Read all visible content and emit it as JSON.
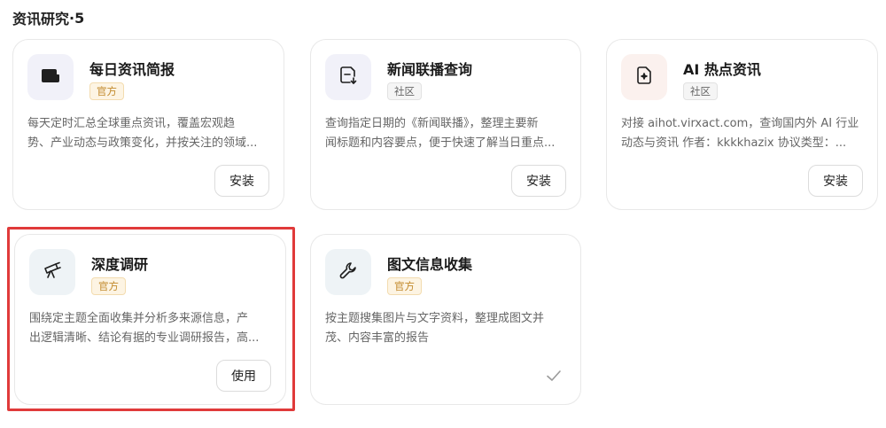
{
  "section": {
    "title": "资讯研究",
    "separator": "·",
    "count": "5"
  },
  "cards": [
    {
      "title": "每日资讯简报",
      "badge": "官方",
      "description": "每天定时汇总全球重点资讯，覆盖宏观趋\n势、产业动态与政策变化，并按关注的领域...",
      "action": "安装",
      "icon": "newspaper-icon"
    },
    {
      "title": "新闻联播查询",
      "badge": "社区",
      "description": "查询指定日期的《新闻联播》，整理主要新\n闻标题和内容要点，便于快速了解当日重点...",
      "action": "安装",
      "icon": "document-download-icon"
    },
    {
      "title": "AI 热点资讯",
      "badge": "社区",
      "description": "对接 aihot.virxact.com，查询国内外 AI 行业\n动态与资讯 作者：kkkkhazix 协议类型：...",
      "action": "安装",
      "icon": "document-sparkle-icon"
    },
    {
      "title": "深度调研",
      "badge": "官方",
      "description": "围绕定主题全面收集并分析多来源信息，产\n出逻辑清晰、结论有据的专业调研报告，高...",
      "action": "使用",
      "icon": "telescope-icon"
    },
    {
      "title": "图文信息收集",
      "badge": "官方",
      "description": "按主题搜集图片与文字资料，整理成图文并\n茂、内容丰富的报告",
      "action": "",
      "icon": "wrench-icon",
      "status": "installed-check-icon"
    }
  ],
  "colors": {
    "highlight_border": "#e03a3a",
    "official_badge_bg": "#fdf4e3",
    "official_badge_text": "#c28a2c",
    "community_badge_bg": "#f5f5f5"
  }
}
